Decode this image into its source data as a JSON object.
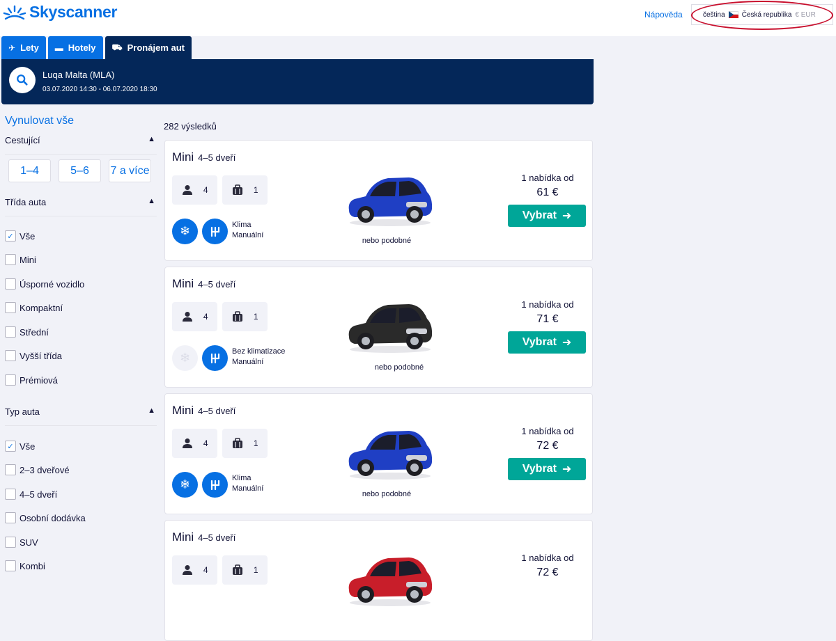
{
  "header": {
    "logo_text": "Skyscanner",
    "help_link": "Nápověda",
    "language": "čeština",
    "country": "Česká republika",
    "currency": "€ EUR"
  },
  "tabs": [
    {
      "label": "Lety",
      "icon": "plane-icon"
    },
    {
      "label": "Hotely",
      "icon": "bed-icon"
    },
    {
      "label": "Pronájem aut",
      "icon": "car-icon",
      "active": true
    }
  ],
  "search": {
    "location": "Luqa Malta (MLA)",
    "dates": "03.07.2020 14:30 - 06.07.2020 18:30"
  },
  "sidebar": {
    "reset": "Vynulovat vše",
    "passengers": {
      "title": "Cestující",
      "options": [
        "1–4",
        "5–6",
        "7 a více"
      ]
    },
    "car_class": {
      "title": "Třída auta",
      "options": [
        {
          "label": "Vše",
          "checked": true
        },
        {
          "label": "Mini",
          "checked": false
        },
        {
          "label": "Úsporné vozidlo",
          "checked": false
        },
        {
          "label": "Kompaktní",
          "checked": false
        },
        {
          "label": "Střední",
          "checked": false
        },
        {
          "label": "Vyšší třída",
          "checked": false
        },
        {
          "label": "Prémiová",
          "checked": false
        }
      ]
    },
    "car_type": {
      "title": "Typ auta",
      "options": [
        {
          "label": "Vše",
          "checked": true
        },
        {
          "label": "2–3 dveřové",
          "checked": false
        },
        {
          "label": "4–5 dveří",
          "checked": false
        },
        {
          "label": "Osobní dodávka",
          "checked": false
        },
        {
          "label": "SUV",
          "checked": false
        },
        {
          "label": "Kombi",
          "checked": false
        }
      ]
    }
  },
  "results": {
    "count": "282 výsledků",
    "cards": [
      {
        "class": "Mini",
        "doors": "4–5 dveří",
        "seats": "4",
        "bags": "1",
        "ac": "Klima",
        "transmission": "Manuální",
        "ac_on": true,
        "car_color": "#1f3fc4",
        "similar": "nebo podobné",
        "offer": "1 nabídka od",
        "price": "61 €",
        "button": "Vybrat"
      },
      {
        "class": "Mini",
        "doors": "4–5 dveří",
        "seats": "4",
        "bags": "1",
        "ac": "Bez klimatizace",
        "transmission": "Manuální",
        "ac_on": false,
        "car_color": "#2a2a2a",
        "similar": "nebo podobné",
        "offer": "1 nabídka od",
        "price": "71 €",
        "button": "Vybrat"
      },
      {
        "class": "Mini",
        "doors": "4–5 dveří",
        "seats": "4",
        "bags": "1",
        "ac": "Klima",
        "transmission": "Manuální",
        "ac_on": true,
        "car_color": "#1f3fc4",
        "similar": "nebo podobné",
        "offer": "1 nabídka od",
        "price": "72 €",
        "button": "Vybrat"
      },
      {
        "class": "Mini",
        "doors": "4–5 dveří",
        "seats": "4",
        "bags": "1",
        "car_color": "#c81e2a",
        "offer": "1 nabídka od",
        "price": "72 €"
      }
    ]
  },
  "colors": {
    "brand": "#0770e3",
    "navy": "#042759",
    "cta": "#00a698"
  }
}
